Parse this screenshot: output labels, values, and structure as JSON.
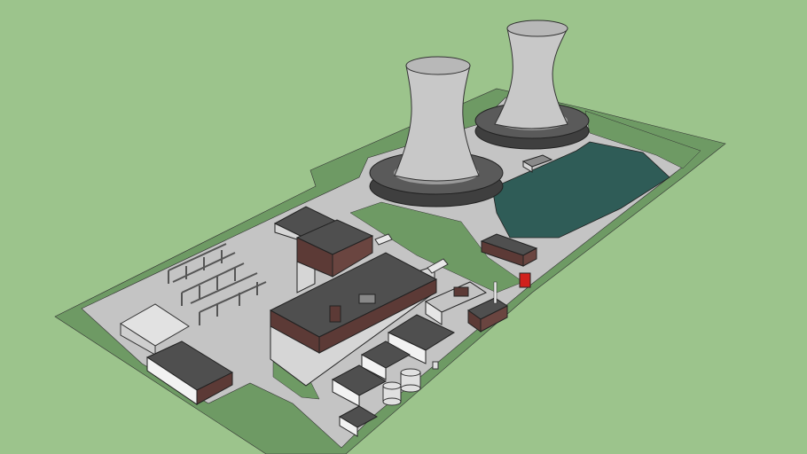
{
  "scene": {
    "colors": {
      "sky_ground": "#9cc48c",
      "lawn": "#6e9a64",
      "pad": "#c4c4c4",
      "road": "#b0b0b0",
      "pond": "#2f5c57",
      "roof": "#4f4f4f",
      "brick": "#5c3a36",
      "wall": "#d6d6d6",
      "tower": "#c8c8c8",
      "tank_red": "#d0201c"
    },
    "objects": [
      "cooling-tower-1",
      "cooling-tower-2",
      "cooling-pond",
      "turbine-hall",
      "switchyard",
      "warehouse",
      "storage-tanks"
    ]
  }
}
